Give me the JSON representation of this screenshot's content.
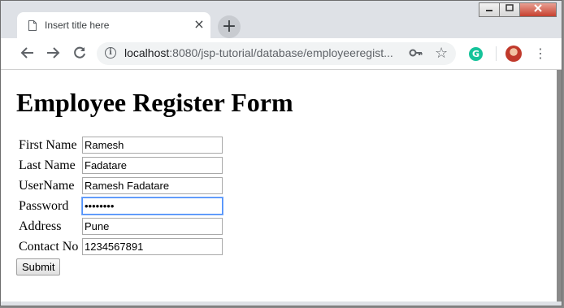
{
  "browser": {
    "tab_title": "Insert title here",
    "tab_close": "×",
    "new_tab": "+",
    "url_host": "localhost",
    "url_path": ":8080/jsp-tutorial/database/employeeregist...",
    "icons": [
      "back-arrow-icon",
      "forward-arrow-icon",
      "reload-icon",
      "info-icon",
      "key-icon",
      "star-icon",
      "grammarly-icon",
      "avatar",
      "menu-icon",
      "doc-icon"
    ]
  },
  "page": {
    "title": "Employee Register Form",
    "fields": [
      {
        "label": "First Name",
        "value": "Ramesh"
      },
      {
        "label": "Last Name",
        "value": "Fadatare"
      },
      {
        "label": "UserName",
        "value": "Ramesh Fadatare"
      },
      {
        "label": "Password",
        "value": "••••••••"
      },
      {
        "label": "Address",
        "value": "Pune"
      },
      {
        "label": "Contact No",
        "value": "1234567891"
      }
    ],
    "submit_label": "Submit"
  }
}
